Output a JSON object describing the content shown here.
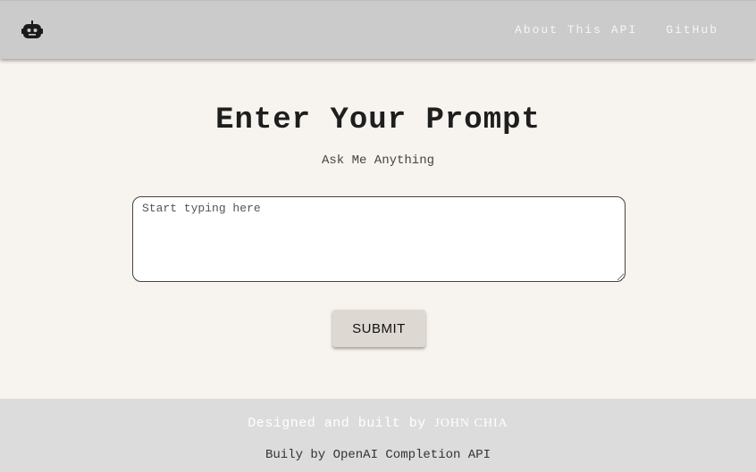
{
  "navbar": {
    "logo_icon": "robot-icon",
    "links": [
      {
        "label": "About This API"
      },
      {
        "label": "GitHub"
      }
    ]
  },
  "main": {
    "title": "Enter Your Prompt",
    "subtitle": "Ask Me Anything",
    "prompt": {
      "placeholder": "Start typing here",
      "value": ""
    },
    "submit_label": "SUBMIT"
  },
  "footer": {
    "credit_prefix": "Designed and built by",
    "credit_name": "JOHN CHIA",
    "built_with": "Buily by OpenAI Completion API"
  },
  "colors": {
    "navbar_bg": "#cbcbcb",
    "page_bg": "#f7f3ef",
    "footer_bg": "#dcdcdc",
    "button_bg": "#ded8d3"
  }
}
